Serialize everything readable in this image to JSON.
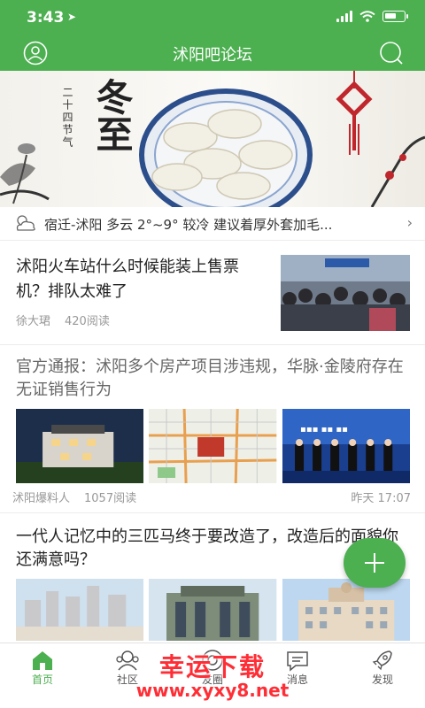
{
  "status_bar": {
    "time": "3:43",
    "location_icon": "location-arrow-icon"
  },
  "nav": {
    "title": "沭阳吧论坛",
    "left_icon": "user-icon",
    "right_icon": "search-icon"
  },
  "banner": {
    "calligraphy": "冬至",
    "subtitle": "二十四节气",
    "accent_color": "#c0272d"
  },
  "weather": {
    "text": "宿迁-沭阳 多云 2°~9° 较冷 建议着厚外套加毛...",
    "icon": "cloud-sun-icon"
  },
  "articles": [
    {
      "title": "沭阳火车站什么时候能装上售票机？排队太难了",
      "author": "徐大珺",
      "reads": "420阅读"
    },
    {
      "title": "官方通报：沭阳多个房产项目涉违规，华脉·金陵府存在无证销售行为",
      "author": "沭阳爆料人",
      "reads": "1057阅读",
      "time": "昨天 17:07"
    },
    {
      "title": "一代人记忆中的三匹马终于要改造了，改造后的面貌你还满意吗？"
    }
  ],
  "tabs": [
    {
      "label": "首页",
      "icon": "home-icon",
      "active": true
    },
    {
      "label": "社区",
      "icon": "community-icon",
      "active": false
    },
    {
      "label": "友圈",
      "icon": "friends-icon",
      "active": false
    },
    {
      "label": "消息",
      "icon": "message-icon",
      "active": false
    },
    {
      "label": "发现",
      "icon": "rocket-icon",
      "active": false
    }
  ],
  "watermark": {
    "line1": "幸运下载",
    "line2": "www.xyxy8.net"
  },
  "colors": {
    "primary": "#4caf50",
    "watermark": "#ff2e36"
  }
}
